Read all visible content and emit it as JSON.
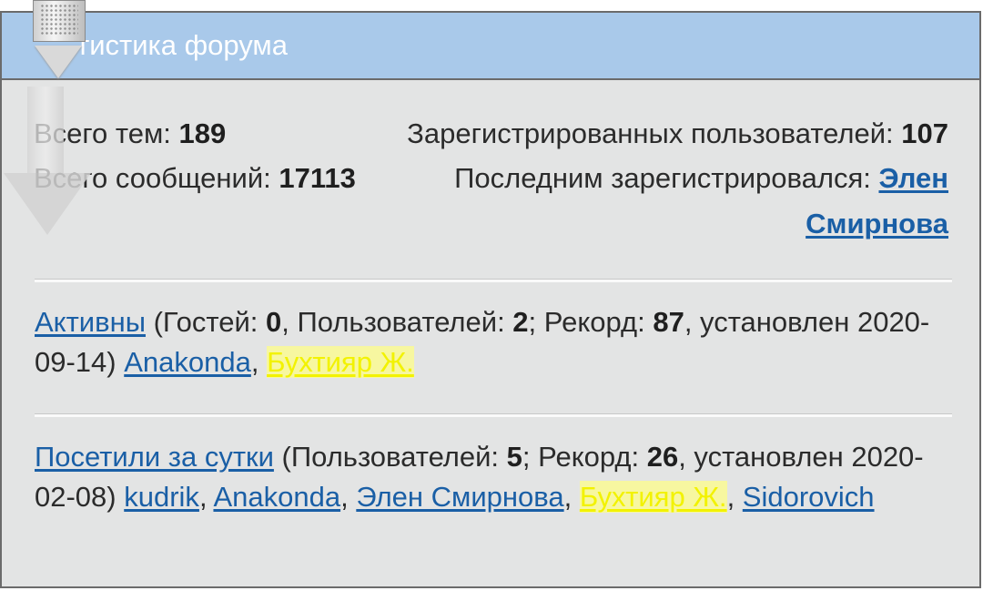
{
  "header": {
    "title": "тистика форума"
  },
  "stats": {
    "topics_label": "Всего тем:",
    "topics_value": "189",
    "posts_label": "Всего сообщений:",
    "posts_value": "17113",
    "registered_label": "Зарегистрированных пользователей:",
    "registered_value": "107",
    "last_registered_label": "Последним зарегистрировался:",
    "last_registered_user_line1": "Элен",
    "last_registered_user_line2": "Смирнова"
  },
  "active": {
    "link": "Активны",
    "t1": " (Гостей: ",
    "guests": "0",
    "t2": ", Пользователей: ",
    "users": "2",
    "t3": "; Рекорд: ",
    "record": "87",
    "t4": ", установлен 2020-09-14) ",
    "user1": "Anakonda",
    "sep1": ", ",
    "user2": "Бухтияр Ж."
  },
  "daily": {
    "link": "Посетили за сутки",
    "t1": " (Пользователей: ",
    "users": "5",
    "t2": "; Рекорд: ",
    "record": "26",
    "t3": ", установлен 2020-02-08) ",
    "user1": "kudrik",
    "sep1": ", ",
    "user2": "Anakonda",
    "sep2": ", ",
    "user3": "Элен Смирнова",
    "sep3": ", ",
    "user4": "Бухтияр Ж.",
    "sep4": ", ",
    "user5": "Sidorovich"
  },
  "colors": {
    "header_bg": "#a9c9ea",
    "panel_bg": "#e3e4e4",
    "link": "#1a5fa6",
    "moderator_link": "#f2f200"
  },
  "icons": {
    "scroll_widget": "scroll-down-arrow-icon"
  }
}
